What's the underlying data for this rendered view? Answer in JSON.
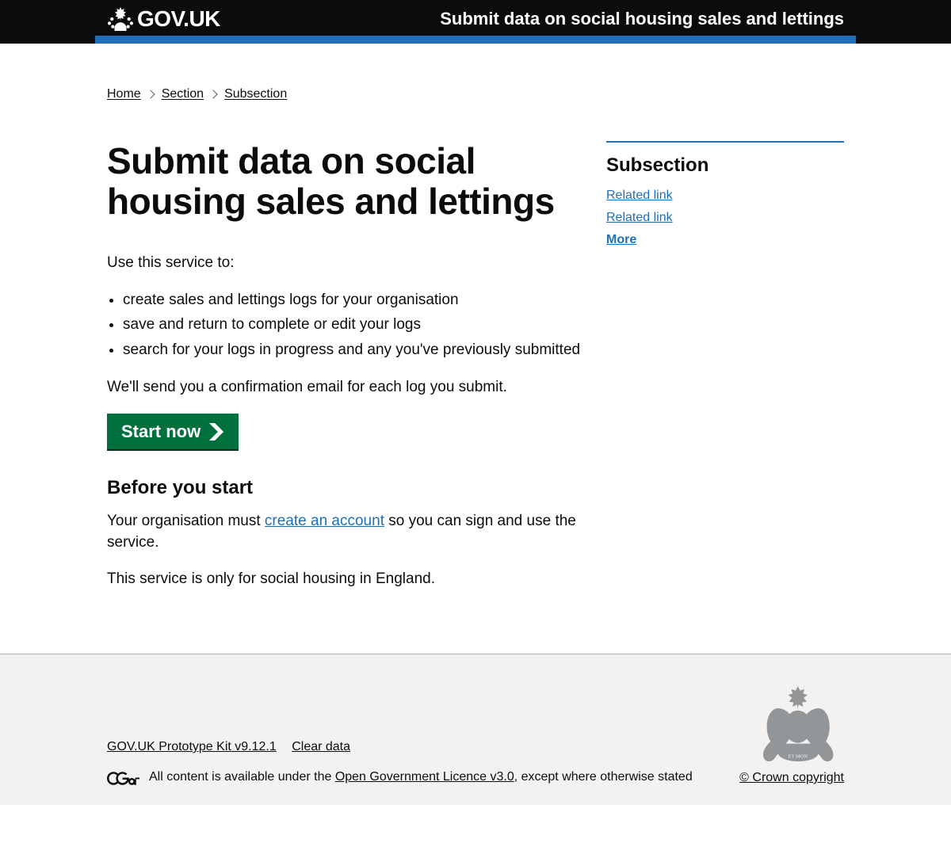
{
  "header": {
    "logo_text": "GOV.UK",
    "service_name": "Submit data on social housing sales and lettings"
  },
  "breadcrumbs": [
    {
      "label": "Home"
    },
    {
      "label": "Section"
    },
    {
      "label": "Subsection"
    }
  ],
  "main": {
    "heading": "Submit data on social housing sales and lettings",
    "intro": "Use this service to:",
    "bullets": [
      "create sales and lettings logs for your organisation",
      "save and return to complete or edit your logs",
      "search for your logs in progress and any you've previously submitted"
    ],
    "confirmation": "We'll send you a confirmation email for each log you submit.",
    "start_label": "Start now",
    "before_heading": "Before you start",
    "before_p1_a": "Your organisation must ",
    "before_p1_link": "create an account",
    "before_p1_b": " so you can sign and use the service.",
    "before_p2": "This service is only for social housing in England."
  },
  "aside": {
    "heading": "Subsection",
    "links": [
      "Related link",
      "Related link"
    ],
    "more": "More"
  },
  "footer": {
    "links": [
      "GOV.UK Prototype Kit v9.12.1",
      "Clear data"
    ],
    "licence_prefix": "All content is available under the ",
    "licence_link": "Open Government Licence v3.0",
    "licence_suffix": ", except where otherwise stated",
    "copyright": "© Crown copyright"
  }
}
